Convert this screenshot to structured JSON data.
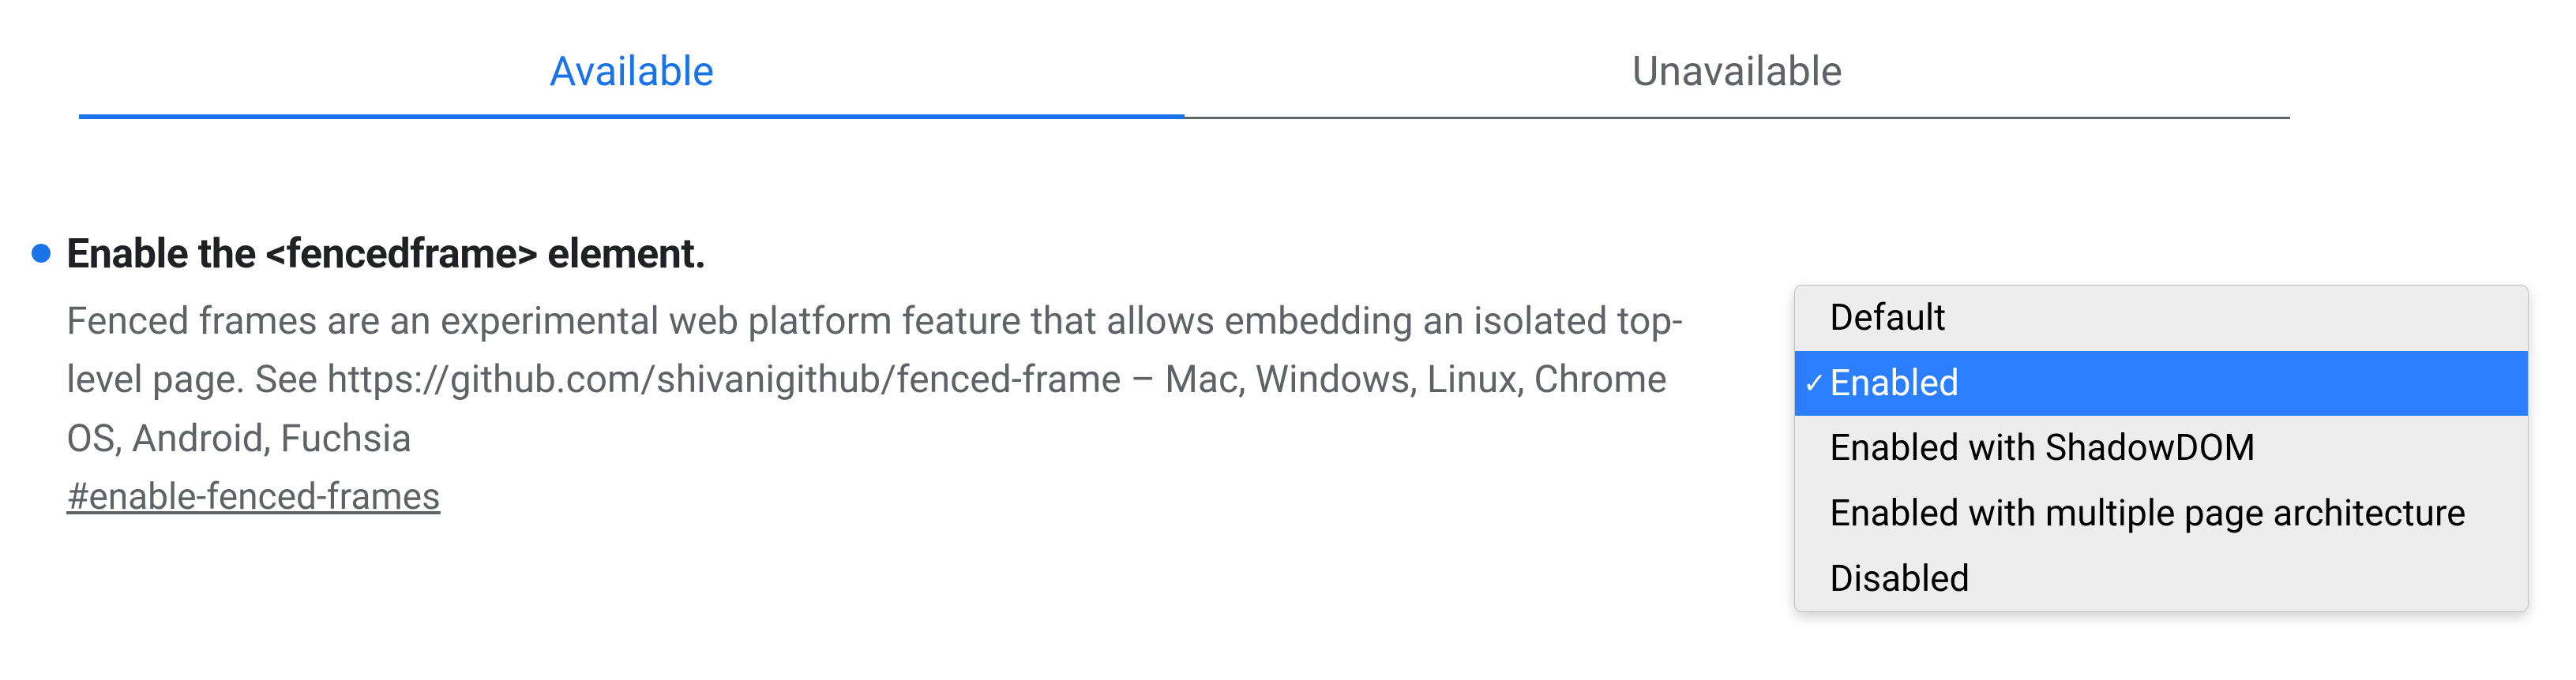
{
  "tabs": {
    "available": "Available",
    "unavailable": "Unavailable"
  },
  "flag": {
    "title": "Enable the <fencedframe> element.",
    "description": "Fenced frames are an experimental web platform feature that allows embedding an isolated top-level page. See https://github.com/shivanigithub/fenced-frame – Mac, Windows, Linux, Chrome OS, Android, Fuchsia",
    "anchor": "#enable-fenced-frames"
  },
  "dropdown": {
    "options": {
      "0": "Default",
      "1": "Enabled",
      "2": "Enabled with ShadowDOM",
      "3": "Enabled with multiple page architecture",
      "4": "Disabled"
    },
    "selected_index": 1
  }
}
